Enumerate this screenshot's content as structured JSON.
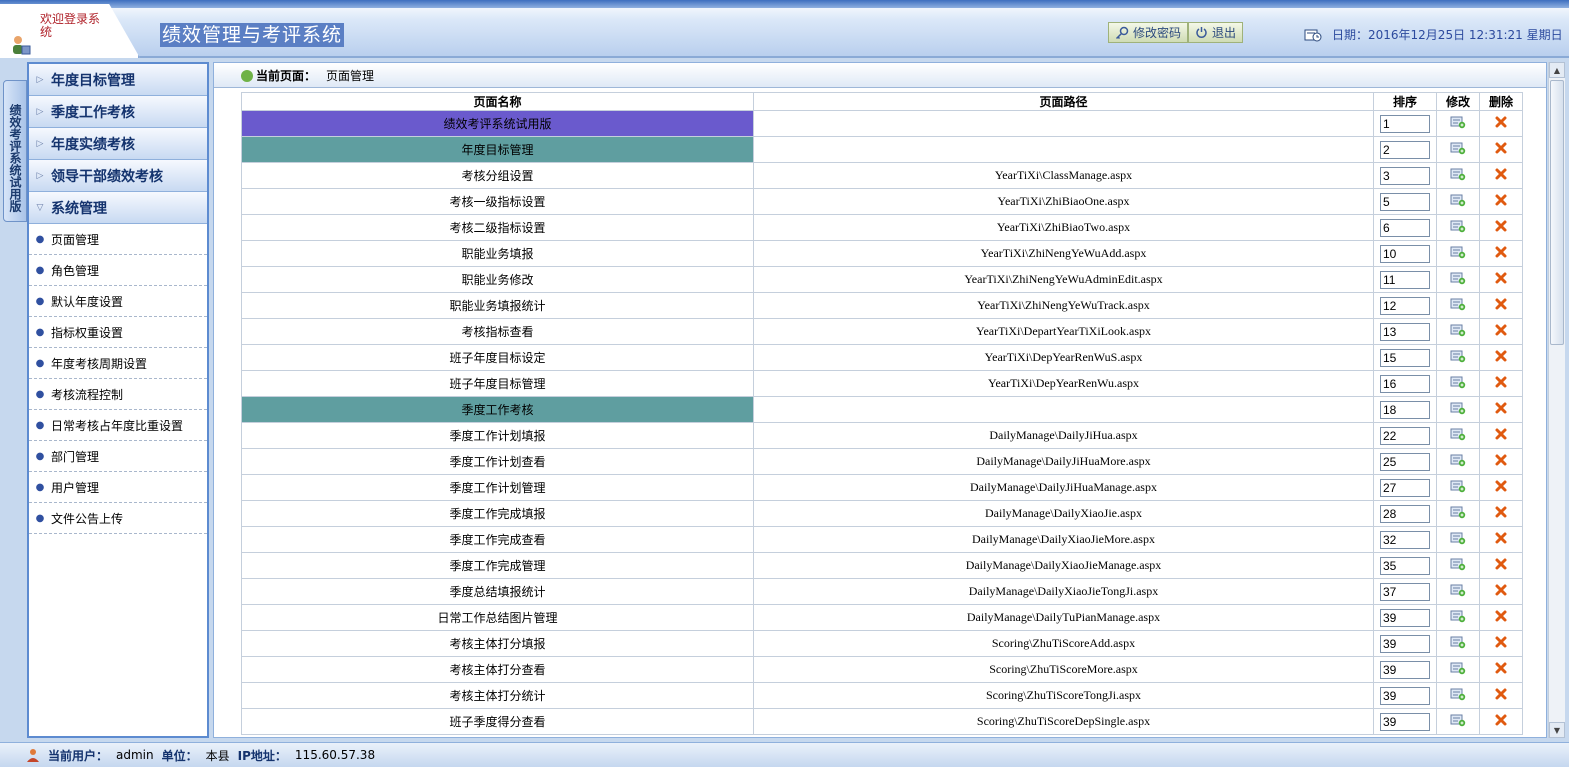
{
  "header": {
    "welcome": "欢迎登录系 统",
    "system_title": "绩效管理与考评系统",
    "change_password": "修改密码",
    "logout": "退出",
    "date_label": "日期：2016年12月25日  12:31:21 星期日"
  },
  "vertical_tab": "绩效考评系统试用版",
  "sidebar": {
    "groups": [
      "年度目标管理",
      "季度工作考核",
      "年度实绩考核",
      "领导干部绩效考核",
      "系统管理"
    ],
    "sub_items": [
      "页面管理",
      "角色管理",
      "默认年度设置",
      "指标权重设置",
      "年度考核周期设置",
      "考核流程控制",
      "日常考核占年度比重设置",
      "部门管理",
      "用户管理",
      "文件公告上传"
    ]
  },
  "main": {
    "crumb_label": "当前页面：",
    "crumb_value": "页面管理",
    "columns": [
      "页面名称",
      "页面路径",
      "排序",
      "修改",
      "删除"
    ],
    "rows": [
      {
        "name": "绩效考评系统试用版",
        "path": "",
        "sort": "1",
        "hl": "purple"
      },
      {
        "name": "年度目标管理",
        "path": "",
        "sort": "2",
        "hl": "teal"
      },
      {
        "name": "考核分组设置",
        "path": "YearTiXi\\ClassManage.aspx",
        "sort": "3"
      },
      {
        "name": "考核一级指标设置",
        "path": "YearTiXi\\ZhiBiaoOne.aspx",
        "sort": "5"
      },
      {
        "name": "考核二级指标设置",
        "path": "YearTiXi\\ZhiBiaoTwo.aspx",
        "sort": "6"
      },
      {
        "name": "职能业务填报",
        "path": "YearTiXi\\ZhiNengYeWuAdd.aspx",
        "sort": "10"
      },
      {
        "name": "职能业务修改",
        "path": "YearTiXi\\ZhiNengYeWuAdminEdit.aspx",
        "sort": "11"
      },
      {
        "name": "职能业务填报统计",
        "path": "YearTiXi\\ZhiNengYeWuTrack.aspx",
        "sort": "12"
      },
      {
        "name": "考核指标查看",
        "path": "YearTiXi\\DepartYearTiXiLook.aspx",
        "sort": "13"
      },
      {
        "name": "班子年度目标设定",
        "path": "YearTiXi\\DepYearRenWuS.aspx",
        "sort": "15"
      },
      {
        "name": "班子年度目标管理",
        "path": "YearTiXi\\DepYearRenWu.aspx",
        "sort": "16"
      },
      {
        "name": "季度工作考核",
        "path": "",
        "sort": "18",
        "hl": "teal"
      },
      {
        "name": "季度工作计划填报",
        "path": "DailyManage\\DailyJiHua.aspx",
        "sort": "22"
      },
      {
        "name": "季度工作计划查看",
        "path": "DailyManage\\DailyJiHuaMore.aspx",
        "sort": "25"
      },
      {
        "name": "季度工作计划管理",
        "path": "DailyManage\\DailyJiHuaManage.aspx",
        "sort": "27"
      },
      {
        "name": "季度工作完成填报",
        "path": "DailyManage\\DailyXiaoJie.aspx",
        "sort": "28"
      },
      {
        "name": "季度工作完成查看",
        "path": "DailyManage\\DailyXiaoJieMore.aspx",
        "sort": "32"
      },
      {
        "name": "季度工作完成管理",
        "path": "DailyManage\\DailyXiaoJieManage.aspx",
        "sort": "35"
      },
      {
        "name": "季度总结填报统计",
        "path": "DailyManage\\DailyXiaoJieTongJi.aspx",
        "sort": "37"
      },
      {
        "name": "日常工作总结图片管理",
        "path": "DailyManage\\DailyTuPianManage.aspx",
        "sort": "39"
      },
      {
        "name": "考核主体打分填报",
        "path": "Scoring\\ZhuTiScoreAdd.aspx",
        "sort": "39"
      },
      {
        "name": "考核主体打分查看",
        "path": "Scoring\\ZhuTiScoreMore.aspx",
        "sort": "39"
      },
      {
        "name": "考核主体打分统计",
        "path": "Scoring\\ZhuTiScoreTongJi.aspx",
        "sort": "39"
      },
      {
        "name": "班子季度得分查看",
        "path": "Scoring\\ZhuTiScoreDepSingle.aspx",
        "sort": "39"
      }
    ]
  },
  "footer": {
    "user_label": "当前用户：",
    "user_value": "admin",
    "unit_label": "单位：",
    "unit_value": "本县",
    "ip_label": "IP地址：",
    "ip_value": "115.60.57.38"
  },
  "colors": {
    "purple_row": "#6a5acd",
    "teal_row": "#5f9ea0",
    "sidebar_border": "#5d8bd0"
  },
  "icons": [
    "user-icon",
    "key-icon",
    "power-icon",
    "clock-icon",
    "edit-icon",
    "delete-icon",
    "play-icon"
  ]
}
